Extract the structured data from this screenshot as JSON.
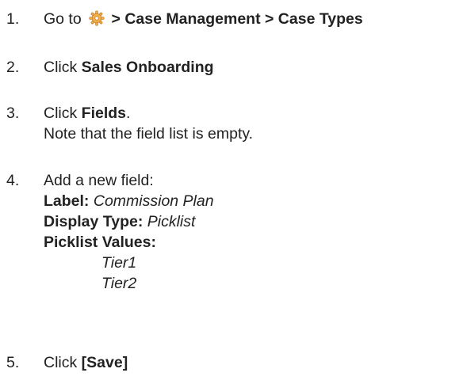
{
  "steps": [
    {
      "number": "1.",
      "prefix": "Go to",
      "icon": "gear-icon",
      "path": "> Case Management > Case Types"
    },
    {
      "number": "2.",
      "prefix": "Click",
      "target": "Sales Onboarding"
    },
    {
      "number": "3.",
      "prefix": "Click",
      "target": "Fields",
      "suffix": ".",
      "note": "Note that the field list is empty."
    },
    {
      "number": "4.",
      "intro": "Add a new field:",
      "label_key": "Label:",
      "label_value": "Commission Plan",
      "display_type_key": "Display Type:",
      "display_type_value": "Picklist",
      "picklist_key": "Picklist Values:",
      "picklist_values": [
        "Tier1",
        "Tier2"
      ]
    },
    {
      "number": "5.",
      "prefix": "Click",
      "target": "[Save]"
    }
  ],
  "colors": {
    "text": "#222222",
    "gear_fill": "#f3b04f",
    "gear_stroke": "#c37a1d"
  }
}
